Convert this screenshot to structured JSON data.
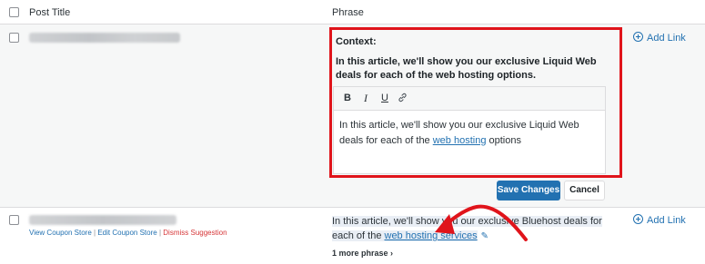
{
  "header": {
    "col_title": "Post Title",
    "col_phrase": "Phrase"
  },
  "row1": {
    "context_label": "Context:",
    "context_sentence": "In this article, we'll show you our exclusive Liquid Web deals for each of the web hosting options.",
    "toolbar": {
      "bold": "B",
      "italic": "I",
      "underline": "U",
      "link_icon": "link-icon"
    },
    "editor": {
      "text_before": "In this article, we'll show you our exclusive Liquid Web deals for each of the ",
      "link_text": "web hosting",
      "text_after": " options"
    },
    "save_label": "Save Changes",
    "cancel_label": "Cancel",
    "add_link_label": "Add Link"
  },
  "row2": {
    "actions": {
      "view": "View Coupon Store",
      "edit": "Edit Coupon Store",
      "dismiss": "Dismiss Suggestion",
      "separator": "|"
    },
    "phrase_before": "In this article, we'll show you our exclusive Bluehost deals for each of the ",
    "phrase_link": "web hosting services",
    "more_phrase": "1 more phrase",
    "add_link_label": "Add Link"
  },
  "colors": {
    "accent": "#2271b1",
    "highlight_border": "#e0141b",
    "dismiss": "#d63638"
  }
}
